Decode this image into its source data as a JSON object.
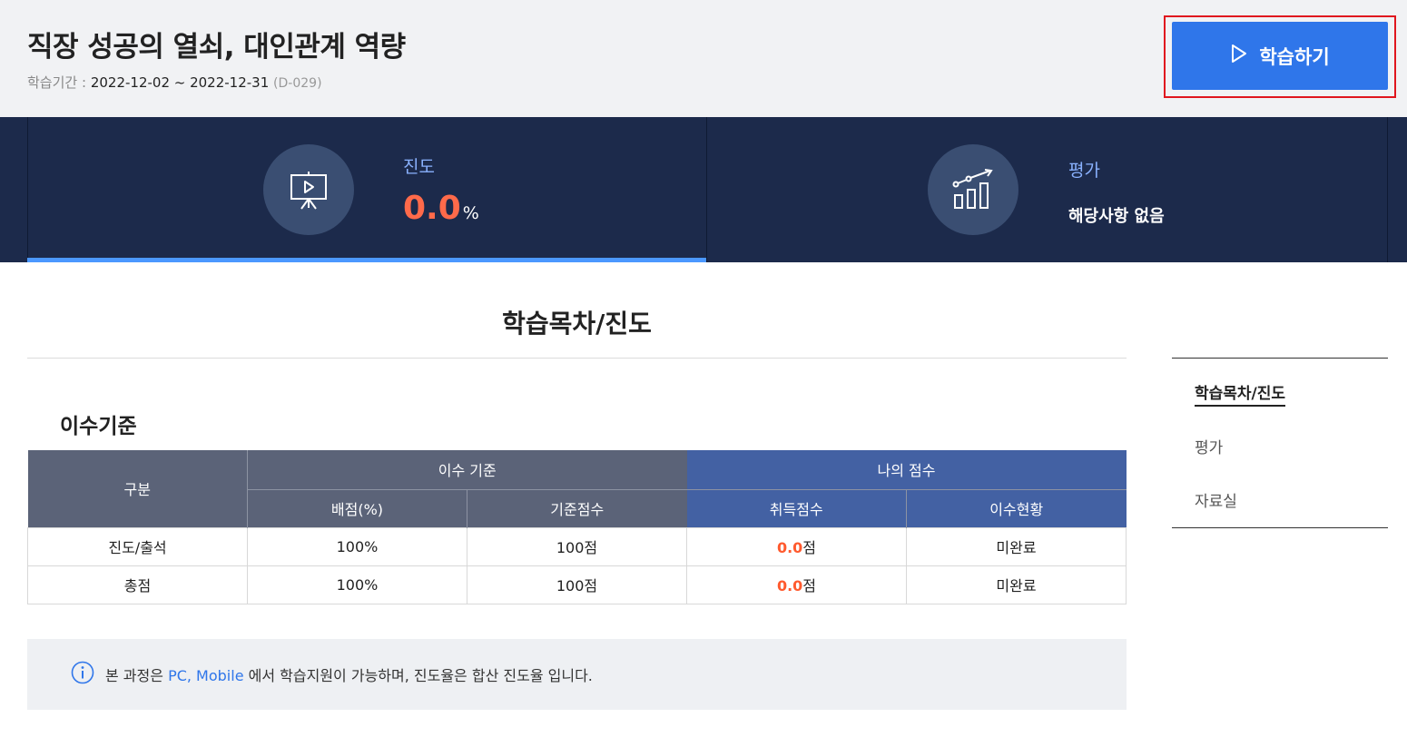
{
  "header": {
    "title": "직장 성공의 열쇠, 대인관계 역량",
    "period_label": "학습기간 :",
    "period_range": "2022-12-02 ~ 2022-12-31",
    "dday": "(D-029)",
    "study_button_label": "학습하기",
    "study_button_icon": "play-outline-icon",
    "accent_color": "#2f76ea"
  },
  "stats": {
    "progress": {
      "label": "진도",
      "value": "0.0",
      "unit": "%",
      "icon": "presentation-play-icon",
      "bar_percent": 0
    },
    "evaluation": {
      "label": "평가",
      "value_text": "해당사항 없음",
      "icon": "growth-chart-icon"
    }
  },
  "main": {
    "section_title": "학습목차/진도",
    "criteria_title": "이수기준",
    "table": {
      "col_category": "구분",
      "group_criteria": "이수 기준",
      "group_my_score": "나의 점수",
      "col_weight": "배점(%)",
      "col_base_score": "기준점수",
      "col_earned": "취득점수",
      "col_status": "이수현황",
      "rows": [
        {
          "category": "진도/출석",
          "weight": "100%",
          "base": "100점",
          "earned": "0.0",
          "earned_unit": "점",
          "status": "미완료"
        },
        {
          "category": "총점",
          "weight": "100%",
          "base": "100점",
          "earned": "0.0",
          "earned_unit": "점",
          "status": "미완료"
        }
      ]
    },
    "notice": {
      "prefix": "본 과정은 ",
      "highlight": "PC, Mobile",
      "suffix": " 에서 학습지원이 가능하며, 진도율은 합산 진도율 입니다."
    }
  },
  "side_nav": {
    "items": [
      {
        "label": "학습목차/진도",
        "active": true
      },
      {
        "label": "평가",
        "active": false
      },
      {
        "label": "자료실",
        "active": false
      }
    ]
  }
}
